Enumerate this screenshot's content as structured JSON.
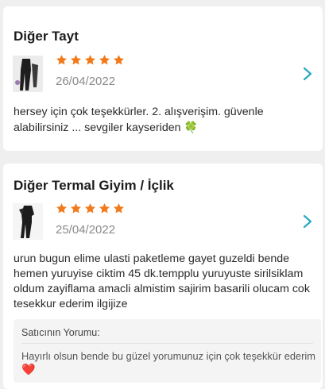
{
  "reviews": [
    {
      "category": "Diğer Tayt",
      "rating": 5,
      "date": "26/04/2022",
      "text": "hersey için çok teşekkürler. 2. alışverişim. güvenle alabilirsiniz ... sevgiler kayseriden",
      "emoji": "🍀"
    },
    {
      "category": "Diğer Termal Giyim / İçlik",
      "rating": 5,
      "date": "25/04/2022",
      "text": "urun bugun elime ulasti paketleme gayet guzeldi bende hemen yuruyise ciktim 45 dk.tempplu yuruyuste sirilsiklam oldum zayiflama amacli almistim sajirim basarili olucam cok tesekkur ederim ilgijize",
      "seller": {
        "title": "Satıcının Yorumu:",
        "reply": "Hayırlı olsun bende bu güzel yorumunuz için çok teşekkür ederim",
        "emoji": "❤️"
      }
    }
  ],
  "colors": {
    "star": "#f27a1a",
    "chevron": "#2aa8c4",
    "date": "#8a8a8a"
  },
  "icons": {
    "star": "star-icon",
    "chevron": "chevron-right-icon"
  }
}
